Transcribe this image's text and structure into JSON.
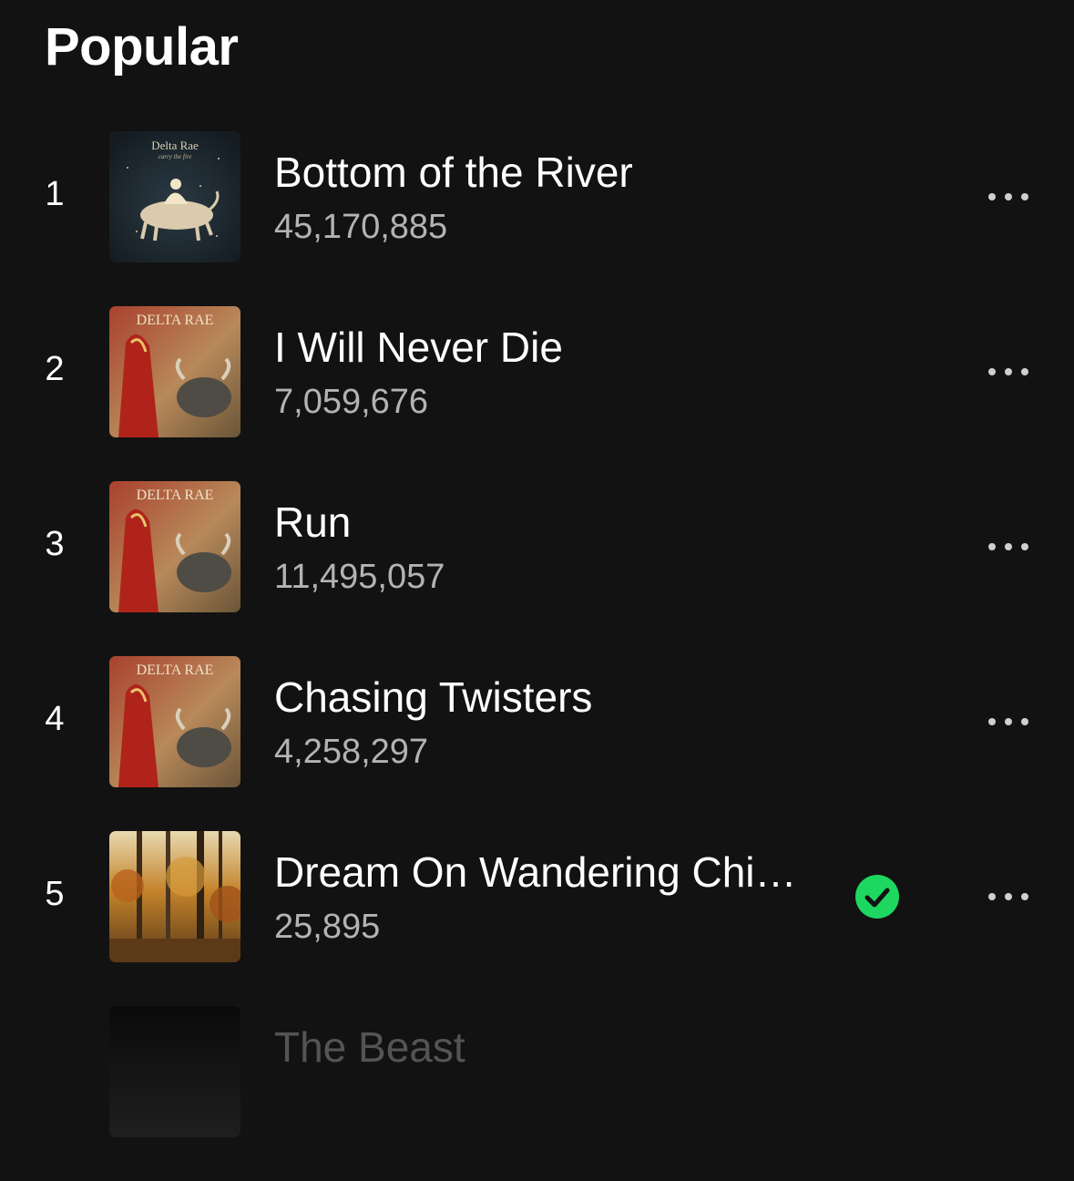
{
  "section": {
    "title": "Popular"
  },
  "tracks": [
    {
      "rank": "1",
      "title": "Bottom of the River",
      "plays": "45,170,885",
      "cover_text": "Delta Rae",
      "cover_subtext": "carry the fire",
      "more_icon": "more-horizontal-icon"
    },
    {
      "rank": "2",
      "title": "I Will Never Die",
      "plays": "7,059,676",
      "cover_text": "DELTA RAE",
      "more_icon": "more-horizontal-icon"
    },
    {
      "rank": "3",
      "title": "Run",
      "plays": "11,495,057",
      "cover_text": "DELTA RAE",
      "more_icon": "more-horizontal-icon"
    },
    {
      "rank": "4",
      "title": "Chasing Twisters",
      "plays": "4,258,297",
      "cover_text": "DELTA RAE",
      "more_icon": "more-horizontal-icon"
    },
    {
      "rank": "5",
      "title": "Dream On Wandering Chi…",
      "plays": "25,895",
      "saved": true,
      "saved_icon": "check-circle-icon",
      "more_icon": "more-horizontal-icon"
    },
    {
      "title": "The Beast"
    }
  ],
  "colors": {
    "background": "#121212",
    "primary_text": "#ffffff",
    "secondary_text": "#b3b3b3",
    "accent": "#1ed760"
  }
}
